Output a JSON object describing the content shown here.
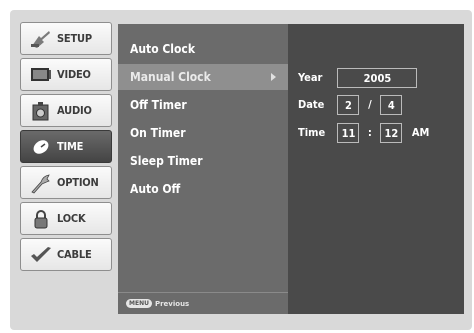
{
  "sidebar": {
    "tabs": [
      {
        "label": "SETUP",
        "icon": "setup-icon",
        "active": false
      },
      {
        "label": "VIDEO",
        "icon": "video-icon",
        "active": false
      },
      {
        "label": "AUDIO",
        "icon": "audio-icon",
        "active": false
      },
      {
        "label": "TIME",
        "icon": "clock-icon",
        "active": true
      },
      {
        "label": "OPTION",
        "icon": "option-icon",
        "active": false
      },
      {
        "label": "LOCK",
        "icon": "lock-icon",
        "active": false
      },
      {
        "label": "CABLE",
        "icon": "cable-icon",
        "active": false
      }
    ]
  },
  "menu": {
    "items": [
      {
        "label": "Auto Clock"
      },
      {
        "label": "Manual Clock",
        "selected": true
      },
      {
        "label": "Off Timer"
      },
      {
        "label": "On Timer"
      },
      {
        "label": "Sleep Timer"
      },
      {
        "label": "Auto Off"
      }
    ],
    "footer": {
      "key": "MENU",
      "label": "Previous"
    }
  },
  "clock": {
    "year_label": "Year",
    "year": "2005",
    "date_label": "Date",
    "month": "2",
    "date_sep": "/",
    "day": "4",
    "time_label": "Time",
    "hour": "11",
    "time_sep": ":",
    "minute": "12",
    "ampm": "AM"
  }
}
